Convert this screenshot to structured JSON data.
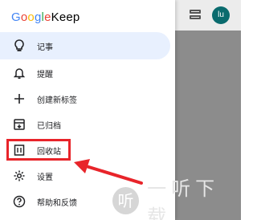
{
  "app": {
    "brand_google": "Google",
    "brand_keep": "Keep"
  },
  "toolbar": {
    "avatar_initials": "lu",
    "view_toggle_icon": "view-list-icon"
  },
  "nav": {
    "items": [
      {
        "label": "记事",
        "icon": "lightbulb-icon",
        "active": true
      },
      {
        "label": "提醒",
        "icon": "bell-icon",
        "active": false
      },
      {
        "label": "创建新标签",
        "icon": "plus-icon",
        "active": false
      },
      {
        "label": "已归档",
        "icon": "archive-icon",
        "active": false
      },
      {
        "label": "回收站",
        "icon": "trash-icon",
        "active": false
      },
      {
        "label": "设置",
        "icon": "gear-icon",
        "active": false
      },
      {
        "label": "帮助和反馈",
        "icon": "help-icon",
        "active": false
      }
    ]
  },
  "annotation": {
    "highlight_color": "#e8242a",
    "target": "回收站"
  },
  "watermark": {
    "logo_char": "听",
    "text": "一听下载"
  },
  "colors": {
    "active_bg": "#e8f0fe",
    "backdrop": "#8c8c8c",
    "avatar_bg": "#0a6b6e"
  }
}
